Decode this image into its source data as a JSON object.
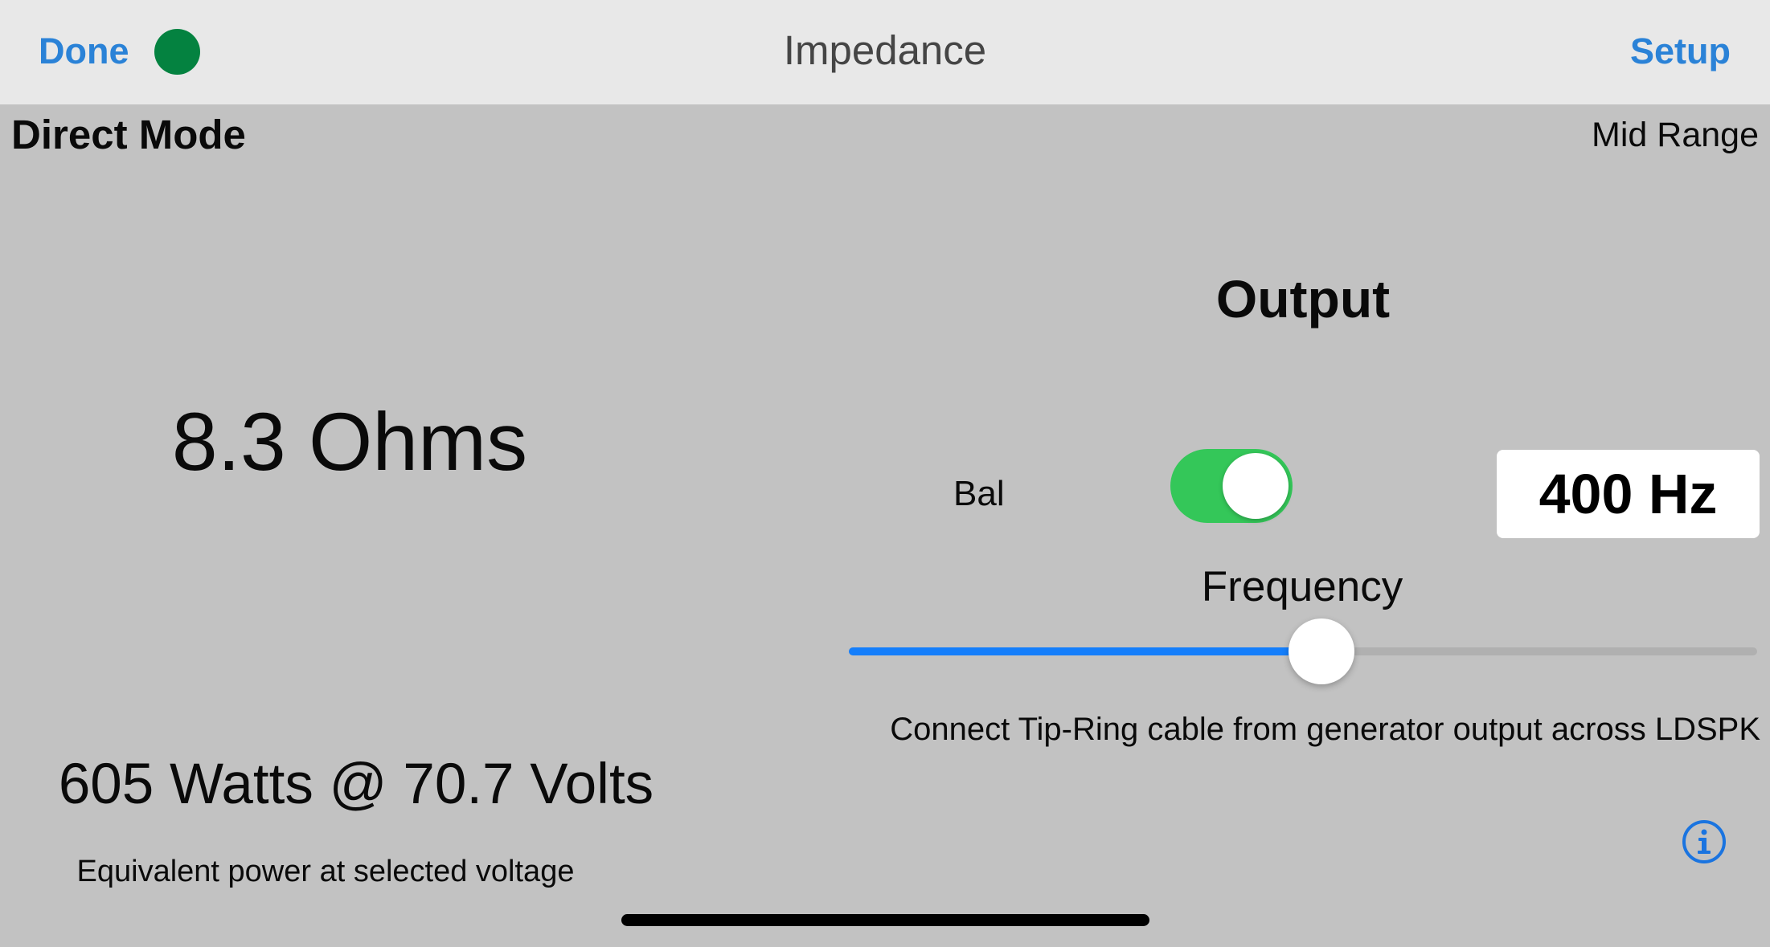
{
  "nav": {
    "done_label": "Done",
    "title": "Impedance",
    "setup_label": "Setup",
    "status_color": "#048240"
  },
  "mode": {
    "label": "Direct Mode",
    "range": "Mid Range"
  },
  "measurement": {
    "impedance": "8.3 Ohms",
    "power": "605 Watts @ 70.7 Volts",
    "power_caption": "Equivalent power at selected voltage"
  },
  "output": {
    "title": "Output",
    "balanced_label": "Bal",
    "balanced_on": true,
    "toggle_on_color": "#34c759",
    "frequency_value": "400 Hz",
    "frequency_label": "Frequency",
    "slider_fraction": 0.52,
    "slider_color": "#147efb",
    "instruction": "Connect Tip-Ring cable from generator output across LDSPK"
  },
  "icons": {
    "info": "info-circle-icon",
    "info_color": "#1a74e0"
  }
}
